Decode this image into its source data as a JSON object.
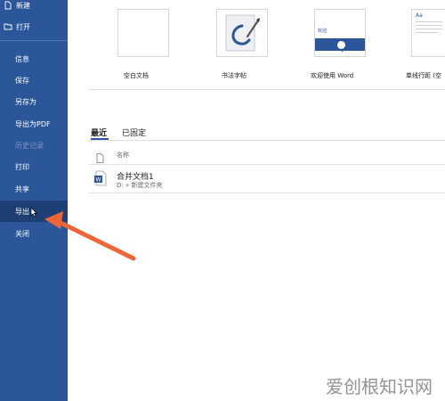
{
  "sidebar": {
    "items": [
      {
        "label": "新建"
      },
      {
        "label": "打开"
      },
      {
        "label": "信息"
      },
      {
        "label": "保存"
      },
      {
        "label": "另存为"
      },
      {
        "label": "导出为PDF"
      },
      {
        "label": "历史记录"
      },
      {
        "label": "打印"
      },
      {
        "label": "共享"
      },
      {
        "label": "导出"
      },
      {
        "label": "关闭"
      }
    ]
  },
  "templates": [
    {
      "label": "空白文档"
    },
    {
      "label": "书法字帖"
    },
    {
      "label": "欢迎使用 Word",
      "thumb_text": "欢迎"
    },
    {
      "label": "单线行距 (空",
      "thumb_text": "Aa"
    }
  ],
  "recent": {
    "tabs": [
      "最近",
      "已固定"
    ],
    "column_name": "名称",
    "files": [
      {
        "name": "合并文档1",
        "path": "D: » 新建文件夹"
      }
    ]
  },
  "watermark": "爱创根知识网",
  "colors": {
    "sidebar": "#2b579a",
    "sidebar_active": "#1e3f73",
    "arrow": "#f0643a"
  }
}
